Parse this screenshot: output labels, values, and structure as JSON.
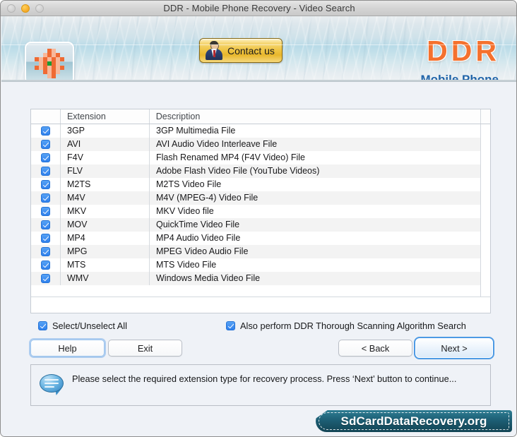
{
  "window": {
    "title": "DDR - Mobile Phone Recovery -  Video Search",
    "traffic_lights": [
      "close",
      "minimize",
      "zoom"
    ]
  },
  "header": {
    "contact_button_label": "Contact us",
    "logo_main": "DDR",
    "logo_sub": "Mobile Phone",
    "logo_color": "#f4712e",
    "logo_sub_color": "#1f63a8"
  },
  "table": {
    "columns": [
      "",
      "Extension",
      "Description"
    ],
    "rows": [
      {
        "checked": true,
        "extension": "3GP",
        "description": "3GP Multimedia File"
      },
      {
        "checked": true,
        "extension": "AVI",
        "description": "AVI Audio Video Interleave File"
      },
      {
        "checked": true,
        "extension": "F4V",
        "description": "Flash Renamed MP4 (F4V Video) File"
      },
      {
        "checked": true,
        "extension": "FLV",
        "description": "Adobe Flash Video File (YouTube Videos)"
      },
      {
        "checked": true,
        "extension": "M2TS",
        "description": "M2TS Video File"
      },
      {
        "checked": true,
        "extension": "M4V",
        "description": "M4V (MPEG-4) Video File"
      },
      {
        "checked": true,
        "extension": "MKV",
        "description": "MKV Video file"
      },
      {
        "checked": true,
        "extension": "MOV",
        "description": "QuickTime Video File"
      },
      {
        "checked": true,
        "extension": "MP4",
        "description": "MP4 Audio Video File"
      },
      {
        "checked": true,
        "extension": "MPG",
        "description": "MPEG Video Audio File"
      },
      {
        "checked": true,
        "extension": "MTS",
        "description": "MTS Video File"
      },
      {
        "checked": true,
        "extension": "WMV",
        "description": "Windows Media Video File"
      }
    ]
  },
  "options": {
    "select_all_label": "Select/Unselect All",
    "select_all_checked": true,
    "thorough_label": "Also perform DDR Thorough Scanning Algorithm Search",
    "thorough_checked": true
  },
  "buttons": {
    "help": "Help",
    "exit": "Exit",
    "back": "< Back",
    "next": "Next >"
  },
  "status": {
    "message": "Please select the required extension type for recovery process. Press ‘Next’ button to continue..."
  },
  "watermark": {
    "text": "SdCardDataRecovery.org",
    "color": "#1d5f75"
  }
}
